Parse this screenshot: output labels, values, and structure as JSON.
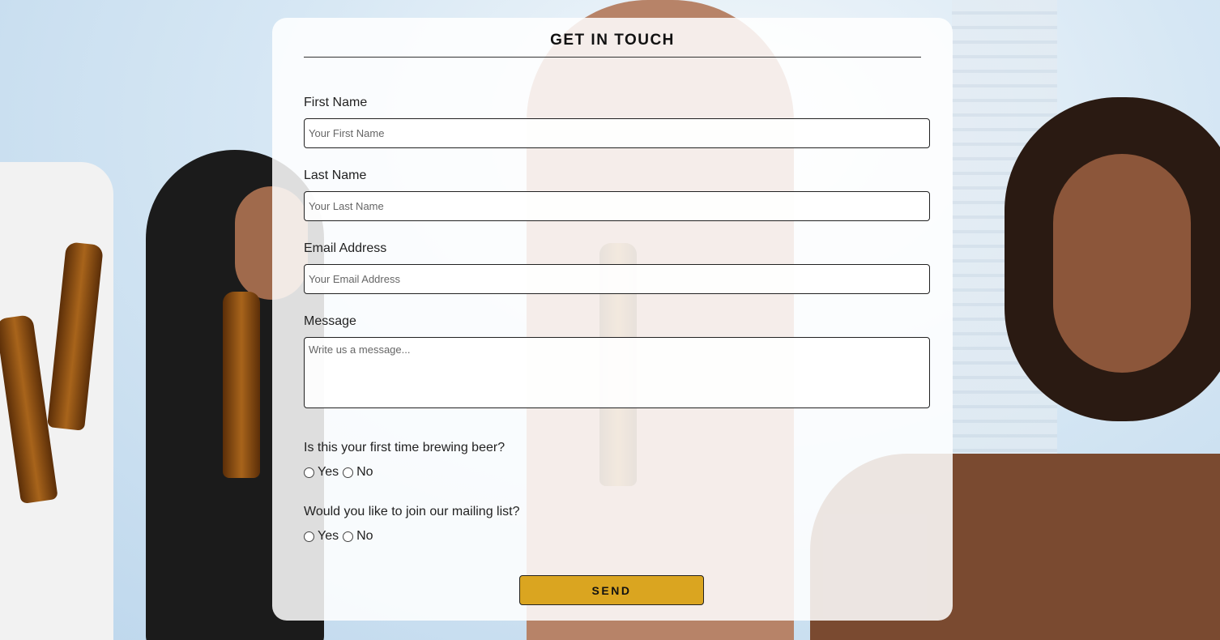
{
  "form": {
    "title": "GET IN TOUCH",
    "fields": [
      {
        "label": "First Name",
        "placeholder": "Your First Name"
      },
      {
        "label": "Last Name",
        "placeholder": "Your Last Name"
      },
      {
        "label": "Email Address",
        "placeholder": "Your Email Address"
      },
      {
        "label": "Message",
        "placeholder": "Write us a message..."
      }
    ],
    "questions": [
      {
        "text": "Is this your first time brewing beer?",
        "yes": "Yes",
        "no": "No"
      },
      {
        "text": "Would you like to join our mailing list?",
        "yes": "Yes",
        "no": "No"
      }
    ],
    "send_label": "SEND"
  },
  "colors": {
    "send_button": "#daa520",
    "card_background": "rgba(255,255,255,0.86)"
  }
}
